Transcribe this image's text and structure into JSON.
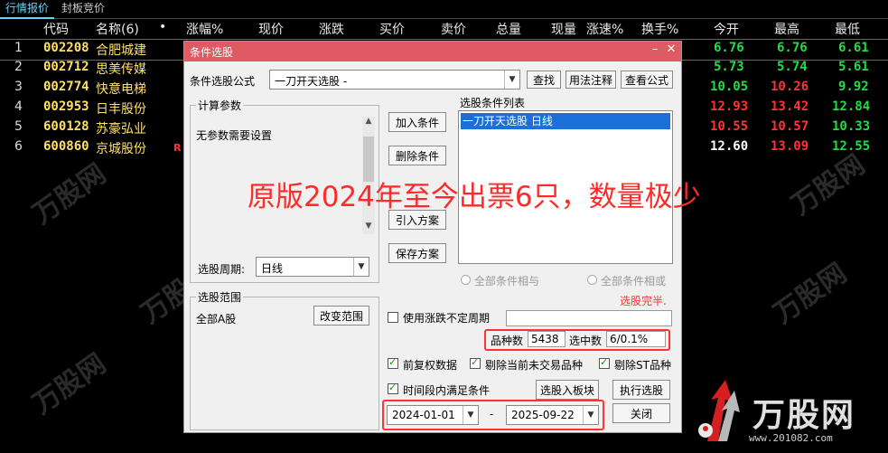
{
  "tabs": [
    "行情报价",
    "封板竞价"
  ],
  "header": {
    "cols": [
      "代码",
      "名称(6)",
      "•",
      "涨幅%",
      "现价",
      "涨跌",
      "买价",
      "卖价",
      "总量",
      "现量",
      "涨速%",
      "换手%",
      "今开",
      "最高",
      "最低"
    ]
  },
  "rows": [
    {
      "idx": "1",
      "code": "002208",
      "name": "合肥城建",
      "mark": "",
      "open": "6.76",
      "high": "6.76",
      "low": "6.61",
      "c": [
        "g",
        "g",
        "g"
      ]
    },
    {
      "idx": "2",
      "code": "002712",
      "name": "思美传媒",
      "mark": "",
      "open": "5.73",
      "high": "5.74",
      "low": "5.61",
      "c": [
        "g",
        "g",
        "g"
      ]
    },
    {
      "idx": "3",
      "code": "002774",
      "name": "快意电梯",
      "mark": "",
      "open": "10.05",
      "high": "10.26",
      "low": "9.92",
      "c": [
        "g",
        "r",
        "g"
      ]
    },
    {
      "idx": "4",
      "code": "002953",
      "name": "日丰股份",
      "mark": "",
      "open": "12.93",
      "high": "13.42",
      "low": "12.84",
      "c": [
        "r",
        "r",
        "g"
      ]
    },
    {
      "idx": "5",
      "code": "600128",
      "name": "苏豪弘业",
      "mark": "",
      "open": "10.55",
      "high": "10.57",
      "low": "10.33",
      "c": [
        "r",
        "r",
        "g"
      ]
    },
    {
      "idx": "6",
      "code": "600860",
      "name": "京城股份",
      "mark": "R",
      "open": "12.60",
      "high": "13.09",
      "low": "12.55",
      "c": [
        "w",
        "r",
        "g"
      ]
    }
  ],
  "dialog": {
    "title": "条件选股",
    "formula_label": "条件选股公式",
    "formula_value": "一刀开天选股  -",
    "find_btn": "查找",
    "usage_btn": "用法注释",
    "view_btn": "查看公式",
    "params_group": "计算参数",
    "params_text": "无参数需要设置",
    "period_label": "选股周期:",
    "period_value": "日线",
    "add_btn": "加入条件",
    "del_btn": "删除条件",
    "import_btn": "引入方案",
    "save_btn": "保存方案",
    "list_label": "选股条件列表",
    "list_items": [
      "一刀开天选股  日线"
    ],
    "radio_and": "全部条件相与",
    "radio_or": "全部条件相或",
    "status": "选股完半.",
    "range_group": "选股范围",
    "range_value": "全部A股",
    "change_range_btn": "改变范围",
    "uncertain_period": "使用涨跌不定周期",
    "count_label": "品种数",
    "count_value": "5438",
    "selected_label": "选中数",
    "selected_value": "6/0.1%",
    "chk_restore": "前复权数据",
    "chk_exclude_untraded": "剔除当前未交易品种",
    "chk_exclude_st": "剔除ST品种",
    "chk_timerange": "时间段内满足条件",
    "to_block_btn": "选股入板块",
    "run_btn": "执行选股",
    "date_from": "2024-01-01",
    "date_sep": "-",
    "date_to": "2025-09-22",
    "close_btn": "关闭"
  },
  "overlay_text": "原版2024年至今出票6只，数量极少",
  "watermark": "万股网",
  "logo_text": "万股网",
  "logo_url": "www.201082.com",
  "colors": {
    "up": "#ff3333",
    "down": "#22dd44",
    "code": "#ffe066",
    "title_bar": "#e05a63",
    "highlight_box": "#ff3333"
  }
}
